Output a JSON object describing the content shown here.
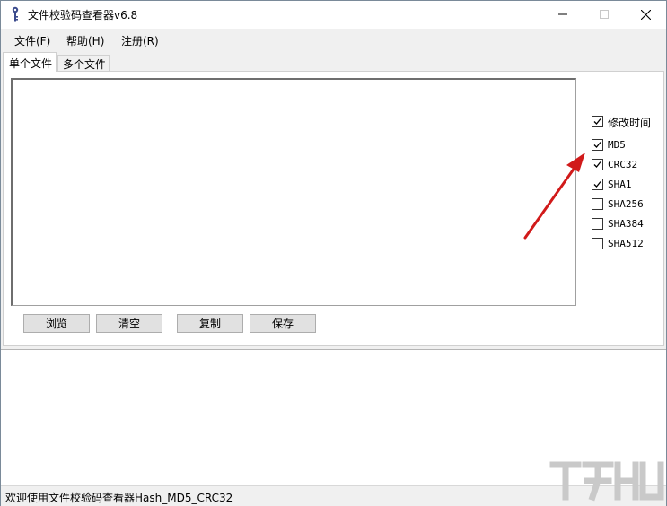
{
  "window": {
    "title": "文件校验码查看器v6.8",
    "icons": {
      "app": "key-icon",
      "minimize": "minimize-icon",
      "maximize": "maximize-icon",
      "close": "close-icon"
    }
  },
  "menu": {
    "items": [
      "文件(F)",
      "帮助(H)",
      "注册(R)"
    ]
  },
  "tabs": [
    {
      "label": "单个文件",
      "active": true
    },
    {
      "label": "多个文件",
      "active": false
    }
  ],
  "output": {
    "value": ""
  },
  "options": [
    {
      "label": "修改时间",
      "checked": true
    },
    {
      "label": "MD5",
      "checked": true
    },
    {
      "label": "CRC32",
      "checked": true
    },
    {
      "label": "SHA1",
      "checked": true
    },
    {
      "label": "SHA256",
      "checked": false
    },
    {
      "label": "SHA384",
      "checked": false
    },
    {
      "label": "SHA512",
      "checked": false
    }
  ],
  "buttons": {
    "browse": "浏览",
    "clear": "清空",
    "copy": "复制",
    "save": "保存"
  },
  "status": {
    "text": "欢迎使用文件校验码查看器Hash_MD5_CRC32"
  },
  "colors": {
    "annotation_arrow": "#d11a1a",
    "menubar_bg": "#f0f0f0"
  }
}
